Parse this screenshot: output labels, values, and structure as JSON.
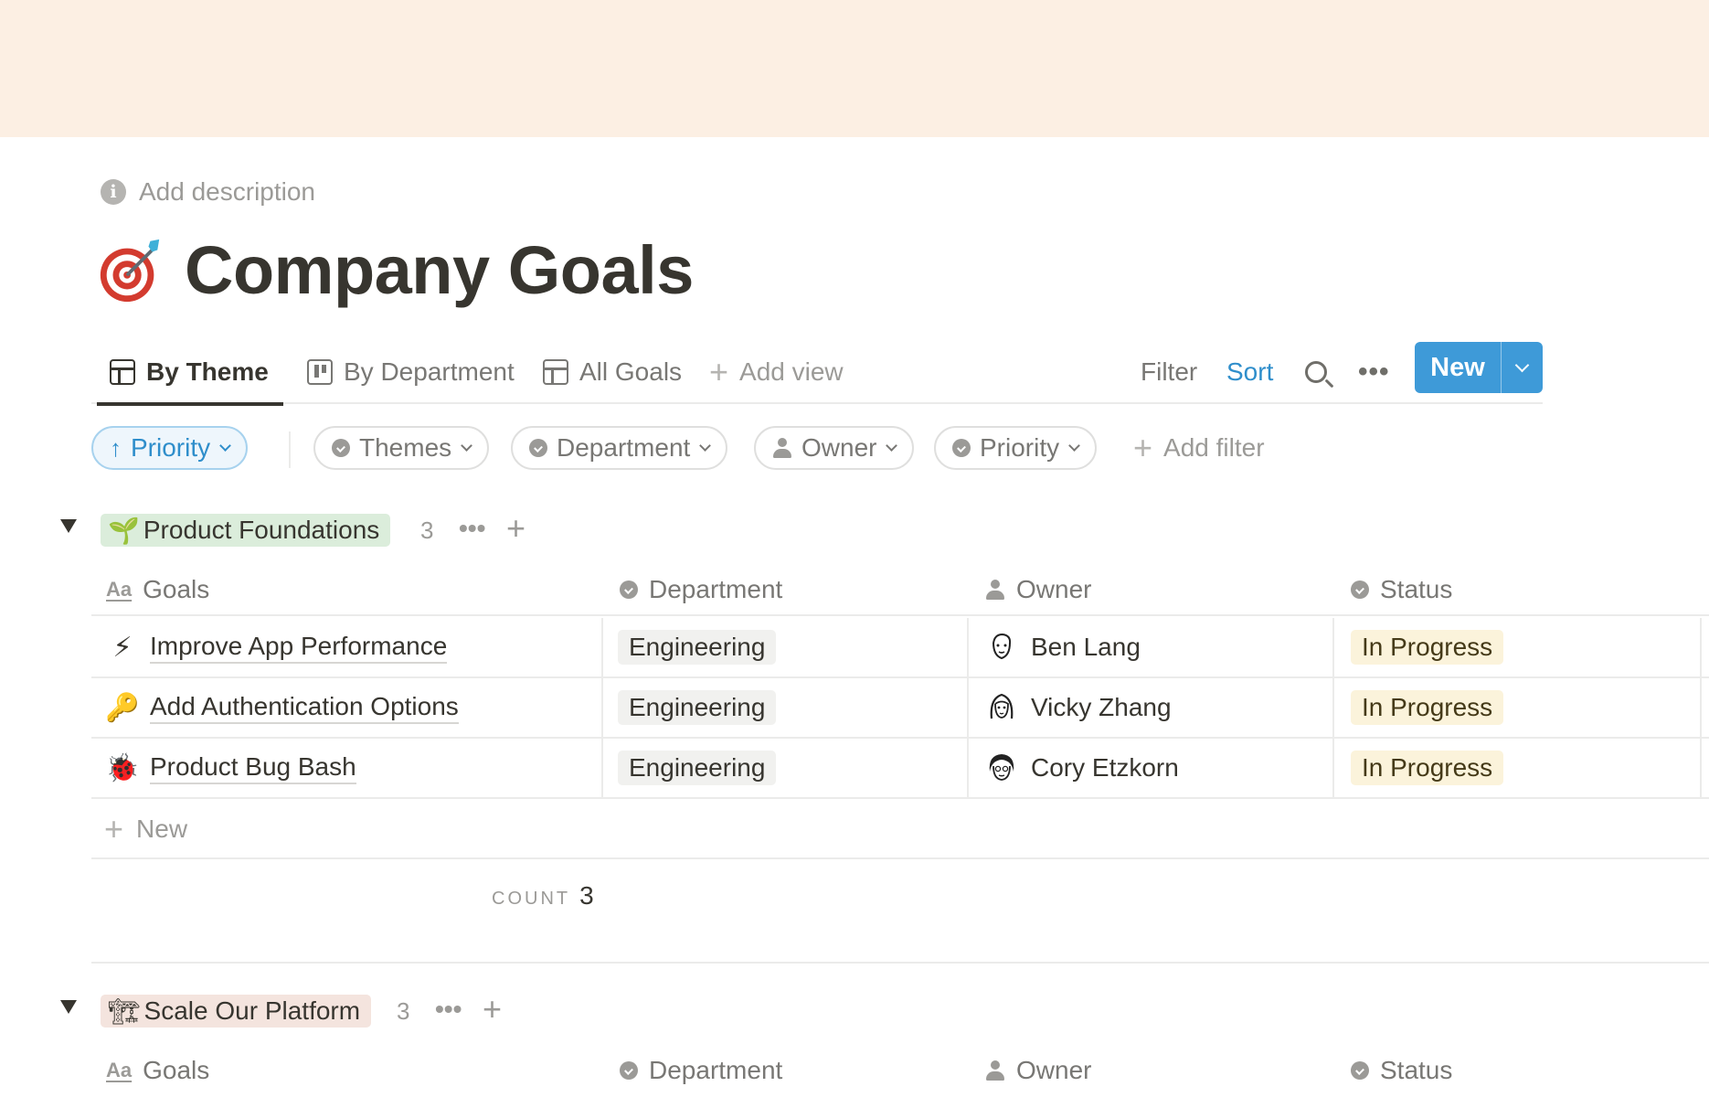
{
  "page": {
    "description": "Add description",
    "title": "Company Goals",
    "title_icon": "target-dart-icon"
  },
  "views": {
    "tabs": [
      {
        "label": "By Theme",
        "icon": "table-icon",
        "active": true
      },
      {
        "label": "By Department",
        "icon": "board-icon",
        "active": false
      },
      {
        "label": "All Goals",
        "icon": "table-icon",
        "active": false
      }
    ],
    "add_view": "Add view",
    "filter": "Filter",
    "sort": "Sort",
    "new_button": "New",
    "accent_color": "#3e9ad8"
  },
  "filters": {
    "sort_pill": "Priority",
    "pills": [
      {
        "label": "Themes",
        "icon": "select-icon"
      },
      {
        "label": "Department",
        "icon": "select-icon"
      },
      {
        "label": "Owner",
        "icon": "person-icon"
      },
      {
        "label": "Priority",
        "icon": "select-icon"
      }
    ],
    "add_filter": "Add filter"
  },
  "columns": {
    "goals": "Goals",
    "department": "Department",
    "owner": "Owner",
    "status": "Status"
  },
  "groups": [
    {
      "name": "Product Foundations",
      "emoji": "🌱",
      "count": "3",
      "tag_color": "#dbeddb",
      "rows": [
        {
          "goal": "Improve App Performance",
          "icon": "⚡",
          "department": "Engineering",
          "owner": "Ben Lang",
          "status": "In Progress"
        },
        {
          "goal": "Add Authentication Options",
          "icon": "🔑",
          "department": "Engineering",
          "owner": "Vicky Zhang",
          "status": "In Progress"
        },
        {
          "goal": "Product Bug Bash",
          "icon": "🐞",
          "department": "Engineering",
          "owner": "Cory Etzkorn",
          "status": "In Progress"
        }
      ],
      "new_label": "New",
      "count_label": "COUNT",
      "count_value": "3"
    },
    {
      "name": "Scale Our Platform",
      "emoji": "🏗",
      "count": "3",
      "tag_color": "#f4e4de"
    }
  ]
}
